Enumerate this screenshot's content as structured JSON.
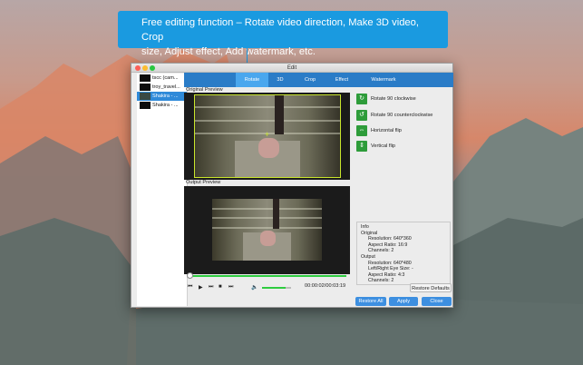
{
  "callout": {
    "line1": "Free editing function – Rotate video direction, Make 3D video, Crop",
    "line2": "size, Adjust effect, Add watermark, etc."
  },
  "window": {
    "title": "Edit"
  },
  "files": [
    {
      "label": "tscc (cam..."
    },
    {
      "label": "troy_travel..."
    },
    {
      "label": "Shakira - ..."
    },
    {
      "label": "Shakira - ..."
    }
  ],
  "tabs": [
    {
      "label": "Rotate"
    },
    {
      "label": "3D"
    },
    {
      "label": "Crop"
    },
    {
      "label": "Effect"
    },
    {
      "label": "Watermark"
    }
  ],
  "preview": {
    "original_label": "Original Preview",
    "output_label": "Output Preview"
  },
  "player": {
    "timecode": "00:00:02/00:03:19",
    "progress": 0.0,
    "volume": 0.8,
    "icons": [
      "previous-icon",
      "play-icon",
      "next-icon",
      "stop-icon",
      "skip-end-icon",
      "volume-icon"
    ]
  },
  "rotate_options": [
    {
      "label": "Rotate 90 clockwise",
      "icon": "rotate-cw-icon"
    },
    {
      "label": "Rotate 90 counterclockwise",
      "icon": "rotate-ccw-icon"
    },
    {
      "label": "Horizontal flip",
      "icon": "flip-horizontal-icon"
    },
    {
      "label": "Vertical flip",
      "icon": "flip-vertical-icon"
    }
  ],
  "info": {
    "title": "Info",
    "original_label": "Original",
    "original_resolution": "Resolution: 640*360",
    "original_aspect": "Aspect Ratio: 16:9",
    "original_channels": "Channels: 2",
    "output_label": "Output",
    "output_resolution": "Resolution: 640*480",
    "output_eye_size": "Left/Right Eye Size: -",
    "output_aspect": "Aspect Ratio: 4:3",
    "output_channels": "Channels: 2"
  },
  "buttons": {
    "restore_defaults": "Restore Defaults",
    "restore_all": "Restore All",
    "apply": "Apply",
    "close": "Close"
  },
  "colors": {
    "accent": "#1a9ae0",
    "tab_bar": "#2a7cc7",
    "tab_active": "#4aa7ee",
    "progress": "#2ecc40",
    "icon_green": "#2e9c3a"
  }
}
